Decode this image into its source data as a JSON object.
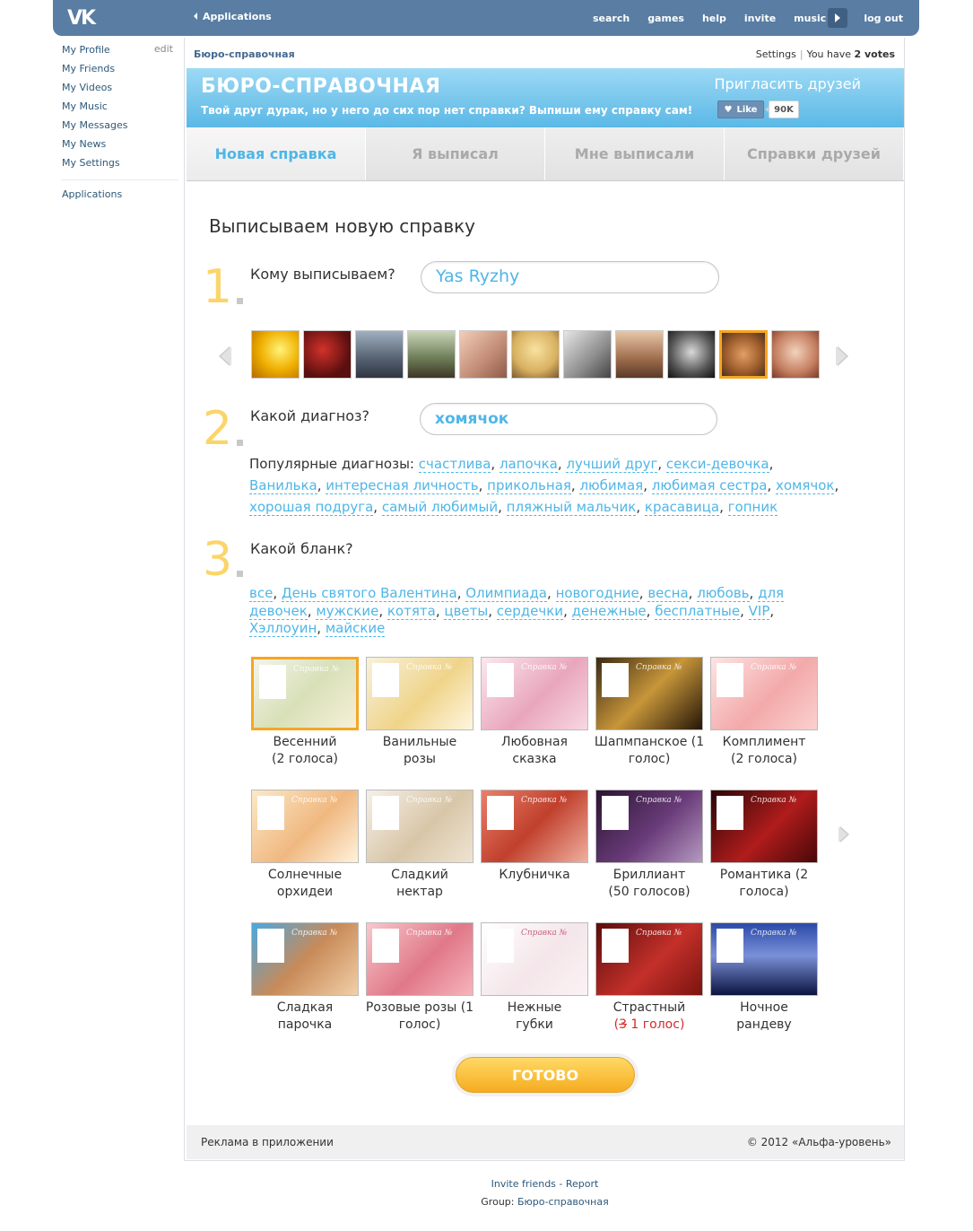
{
  "topbar": {
    "logo": "VK",
    "apps_label": "Applications",
    "nav": [
      "search",
      "games",
      "help",
      "invite",
      "music",
      "log out"
    ]
  },
  "leftmenu": {
    "items": [
      "My Profile",
      "My Friends",
      "My Videos",
      "My Music",
      "My Messages",
      "My News",
      "My Settings"
    ],
    "edit": "edit",
    "applications": "Applications"
  },
  "app": {
    "name": "Бюро-справочная",
    "settings": "Settings",
    "votes_prefix": "You have",
    "votes_count": "2 votes",
    "banner": {
      "title": "БЮРО-СПРАВОЧНАЯ",
      "subtitle": "Твой друг дурак, но у него до сих пор нет справки? Выпиши ему справку сам!",
      "invite": "Пригласить друзей",
      "like": "Like",
      "like_count": "90K"
    },
    "tabs": [
      "Новая справка",
      "Я выписал",
      "Мне выписали",
      "Справки друзей"
    ],
    "heading": "Выписываем новую справку",
    "step1": {
      "num": "1",
      "question": "Кому выписываем?",
      "value": "Yas Ryzhy"
    },
    "step2": {
      "num": "2",
      "question": "Какой диагноз?",
      "value": "хомячок",
      "popular_label": "Популярные диагнозы:"
    },
    "diagnoses": [
      "счастлива",
      "лапочка",
      "лучший друг",
      "секси-девочка",
      "Ванилька",
      "интересная личность",
      "прикольная",
      "любимая",
      "любимая сестра",
      "хомячок",
      "хорошая подруга",
      "самый любимый",
      "пляжный мальчик",
      "красавица",
      "гопник"
    ],
    "step3": {
      "num": "3",
      "question": "Какой бланк?"
    },
    "blank_categories": [
      "все",
      "День святого Валентина",
      "Олимпиада",
      "новогодние",
      "весна",
      "любовь",
      "для девочек",
      "мужские",
      "котята",
      "цветы",
      "сердечки",
      "денежные",
      "бесплатные",
      "VIP",
      "Хэллоуин",
      "майские"
    ],
    "blanks": [
      {
        "l1": "Весенний",
        "l2": "(2 голоса)"
      },
      {
        "l1": "Ванильные",
        "l2": "розы"
      },
      {
        "l1": "Любовная",
        "l2": "сказка"
      },
      {
        "l1": "Шапмпанское (1",
        "l2": "голос)"
      },
      {
        "l1": "Комплимент",
        "l2": "(2 голоса)"
      },
      {
        "l1": "Солнечные",
        "l2": "орхидеи"
      },
      {
        "l1": "Сладкий",
        "l2": "нектар"
      },
      {
        "l1": "Клубничка",
        "l2": ""
      },
      {
        "l1": "Бриллиант",
        "l2": "(50 голосов)"
      },
      {
        "l1": "Романтика (2",
        "l2": "голоса)"
      },
      {
        "l1": "Сладкая",
        "l2": "парочка"
      },
      {
        "l1": "Розовые розы (1",
        "l2": "голос)"
      },
      {
        "l1": "Нежные",
        "l2": "губки"
      },
      {
        "l1": "Страстный",
        "l2_open": "(",
        "l2_strike": "3",
        "l2_rest": " 1 голос",
        "l2_close": ")"
      },
      {
        "l1": "Ночное",
        "l2": "рандеву"
      }
    ],
    "card_header": "Справка №",
    "done": "ГОТОВО",
    "footer_left": "Реклама в приложении",
    "footer_right": "© 2012 «Альфа-уровень»"
  },
  "bottom": {
    "invite": "Invite friends",
    "sep": " - ",
    "report": "Report",
    "group_label": "Group:",
    "group_name": "Бюро-справочная"
  },
  "colors": {
    "accent": "#4fb6e7",
    "step_number": "#fbd56a",
    "topbar": "#597da3",
    "selected": "#f5a623"
  }
}
